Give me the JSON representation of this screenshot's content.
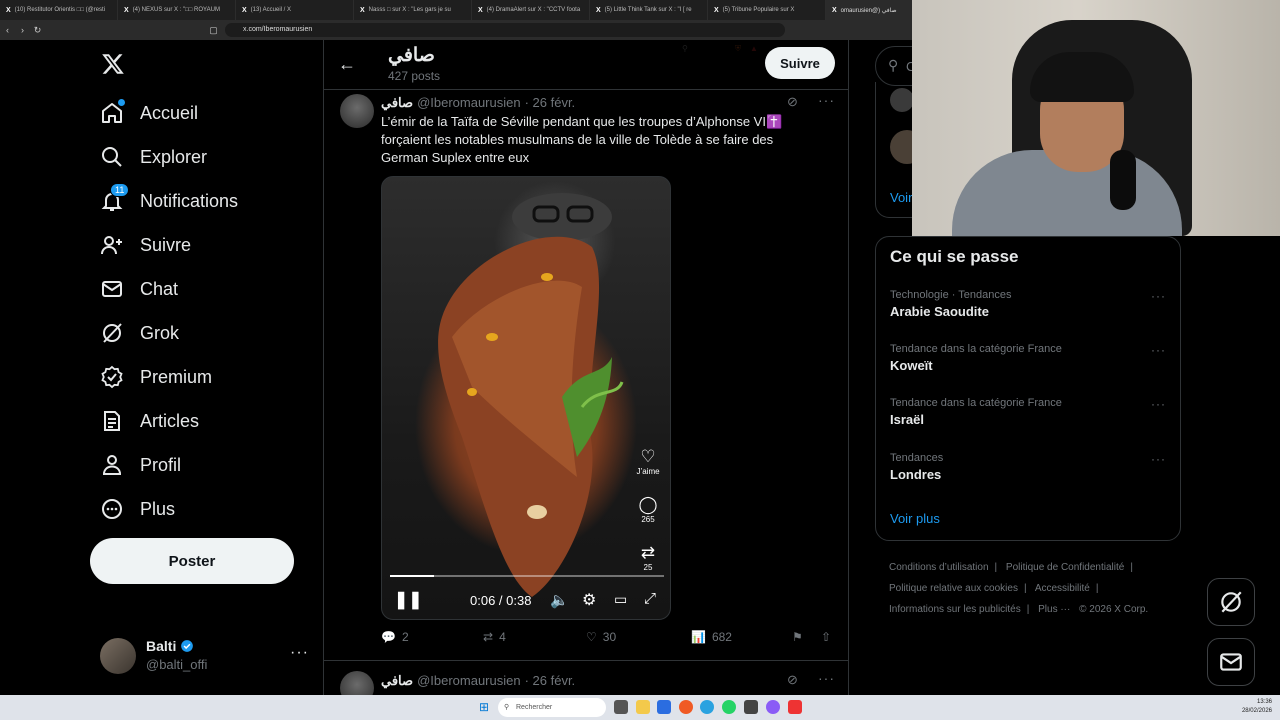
{
  "browser": {
    "tabs": [
      {
        "icon": "X",
        "label": "(10) Restitutor Orientis □□ (@resti"
      },
      {
        "icon": "X",
        "label": "(4) NEXUS sur X : \"□□ ROYAUM"
      },
      {
        "icon": "X",
        "label": "(13) Accueil / X"
      },
      {
        "icon": "X",
        "label": "Nasss □ sur X : \"Les gars je su"
      },
      {
        "icon": "X",
        "label": "(4) DramaAlert sur X : \"CCTV foota"
      },
      {
        "icon": "X",
        "label": "(5) Little Think Tank sur X : \"I [ re"
      },
      {
        "icon": "X",
        "label": "(5) Tribune Populaire sur X"
      },
      {
        "icon": "X",
        "label": "omaurusien@) صافي"
      }
    ],
    "url": "x.com/Iberomaurusien"
  },
  "sidebar": {
    "items": [
      {
        "label": "Accueil",
        "icon": "home-icon"
      },
      {
        "label": "Explorer",
        "icon": "search-icon"
      },
      {
        "label": "Notifications",
        "icon": "bell-icon",
        "badge": "11"
      },
      {
        "label": "Suivre",
        "icon": "add-person-icon"
      },
      {
        "label": "Chat",
        "icon": "mail-icon"
      },
      {
        "label": "Grok",
        "icon": "grok-icon"
      },
      {
        "label": "Premium",
        "icon": "verified-icon"
      },
      {
        "label": "Articles",
        "icon": "article-icon"
      },
      {
        "label": "Profil",
        "icon": "person-icon"
      },
      {
        "label": "Plus",
        "icon": "more-circle-icon"
      }
    ],
    "post_button": "Poster",
    "account": {
      "name": "Balti",
      "handle": "@balti_offi"
    }
  },
  "profile_header": {
    "name": "صافي",
    "post_count": "427 posts",
    "follow_button": "Suivre"
  },
  "post": {
    "author_name": "صافي",
    "handle": "@Iberomaurusien",
    "date": "· 26 févr.",
    "text": "L’émir de la Taïfa de Séville pendant que les troupes d’Alphonse VI✝️ forçaient les notables musulmans de la ville de Tolède à se faire des German Suplex entre eux",
    "video": {
      "time": "0:06 / 0:38",
      "progress": 0.16,
      "side_like_label": "J’aime",
      "side_comments": "265",
      "side_reposts": "25"
    },
    "actions": {
      "replies": "2",
      "reposts": "4",
      "likes": "30",
      "views": "682"
    }
  },
  "post2": {
    "author_name": "صافي",
    "handle": "@Iberomaurusien",
    "date": "· 26 févr."
  },
  "right": {
    "search_placeholder": "C",
    "who_to_follow_more": "Voir",
    "trends_title": "Ce qui se passe",
    "trends": [
      {
        "meta": "Technologie · Tendances",
        "name": "Arabie Saoudite"
      },
      {
        "meta": "Tendance dans la catégorie France",
        "name": "Koweït"
      },
      {
        "meta": "Tendance dans la catégorie France",
        "name": "Israël"
      },
      {
        "meta": "Tendances",
        "name": "Londres"
      }
    ],
    "show_more": "Voir plus",
    "footer_links": [
      "Conditions d’utilisation",
      "Politique de Confidentialité",
      "Politique relative aux cookies",
      "Accessibilité",
      "Informations sur les publicités",
      "Plus ···",
      "© 2026 X Corp."
    ]
  },
  "taskbar": {
    "search_placeholder": "Rechercher",
    "time": "13:36",
    "date": "28/02/2026"
  },
  "colors": {
    "accent": "#1d9bf0",
    "background": "#000000",
    "border": "#2f3336",
    "muted": "#71767b"
  }
}
